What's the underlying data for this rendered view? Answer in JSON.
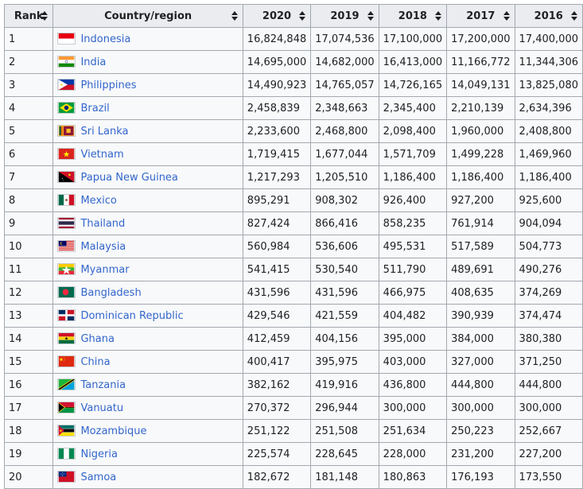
{
  "columns": {
    "rank": "Rank",
    "country": "Country/region",
    "y2020": "2020",
    "y2019": "2019",
    "y2018": "2018",
    "y2017": "2017",
    "y2016": "2016"
  },
  "rows": [
    {
      "rank": "1",
      "country": "Indonesia",
      "flag": "indonesia-flag-icon",
      "v2020": "16,824,848",
      "v2019": "17,074,536",
      "v2018": "17,100,000",
      "v2017": "17,200,000",
      "v2016": "17,400,000"
    },
    {
      "rank": "2",
      "country": "India",
      "flag": "india-flag-icon",
      "v2020": "14,695,000",
      "v2019": "14,682,000",
      "v2018": "16,413,000",
      "v2017": "11,166,772",
      "v2016": "11,344,306"
    },
    {
      "rank": "3",
      "country": "Philippines",
      "flag": "philippines-flag-icon",
      "v2020": "14,490,923",
      "v2019": "14,765,057",
      "v2018": "14,726,165",
      "v2017": "14,049,131",
      "v2016": "13,825,080"
    },
    {
      "rank": "4",
      "country": "Brazil",
      "flag": "brazil-flag-icon",
      "v2020": "2,458,839",
      "v2019": "2,348,663",
      "v2018": "2,345,400",
      "v2017": "2,210,139",
      "v2016": "2,634,396"
    },
    {
      "rank": "5",
      "country": "Sri Lanka",
      "flag": "sri-lanka-flag-icon",
      "v2020": "2,233,600",
      "v2019": "2,468,800",
      "v2018": "2,098,400",
      "v2017": "1,960,000",
      "v2016": "2,408,800"
    },
    {
      "rank": "6",
      "country": "Vietnam",
      "flag": "vietnam-flag-icon",
      "v2020": "1,719,415",
      "v2019": "1,677,044",
      "v2018": "1,571,709",
      "v2017": "1,499,228",
      "v2016": "1,469,960"
    },
    {
      "rank": "7",
      "country": "Papua New Guinea",
      "flag": "papua-new-guinea-flag-icon",
      "v2020": "1,217,293",
      "v2019": "1,205,510",
      "v2018": "1,186,400",
      "v2017": "1,186,400",
      "v2016": "1,186,400"
    },
    {
      "rank": "8",
      "country": "Mexico",
      "flag": "mexico-flag-icon",
      "v2020": "895,291",
      "v2019": "908,302",
      "v2018": "926,400",
      "v2017": "927,200",
      "v2016": "925,600"
    },
    {
      "rank": "9",
      "country": "Thailand",
      "flag": "thailand-flag-icon",
      "v2020": "827,424",
      "v2019": "866,416",
      "v2018": "858,235",
      "v2017": "761,914",
      "v2016": "904,094"
    },
    {
      "rank": "10",
      "country": "Malaysia",
      "flag": "malaysia-flag-icon",
      "v2020": "560,984",
      "v2019": "536,606",
      "v2018": "495,531",
      "v2017": "517,589",
      "v2016": "504,773"
    },
    {
      "rank": "11",
      "country": "Myanmar",
      "flag": "myanmar-flag-icon",
      "v2020": "541,415",
      "v2019": "530,540",
      "v2018": "511,790",
      "v2017": "489,691",
      "v2016": "490,276"
    },
    {
      "rank": "12",
      "country": "Bangladesh",
      "flag": "bangladesh-flag-icon",
      "v2020": "431,596",
      "v2019": "431,596",
      "v2018": "466,975",
      "v2017": "408,635",
      "v2016": "374,269"
    },
    {
      "rank": "13",
      "country": "Dominican Republic",
      "flag": "dominican-republic-flag-icon",
      "v2020": "429,546",
      "v2019": "421,559",
      "v2018": "404,482",
      "v2017": "390,939",
      "v2016": "374,474"
    },
    {
      "rank": "14",
      "country": "Ghana",
      "flag": "ghana-flag-icon",
      "v2020": "412,459",
      "v2019": "404,156",
      "v2018": "395,000",
      "v2017": "384,000",
      "v2016": "380,380"
    },
    {
      "rank": "15",
      "country": "China",
      "flag": "china-flag-icon",
      "v2020": "400,417",
      "v2019": "395,975",
      "v2018": "403,000",
      "v2017": "327,000",
      "v2016": "371,250"
    },
    {
      "rank": "16",
      "country": "Tanzania",
      "flag": "tanzania-flag-icon",
      "v2020": "382,162",
      "v2019": "419,916",
      "v2018": "436,800",
      "v2017": "444,800",
      "v2016": "444,800"
    },
    {
      "rank": "17",
      "country": "Vanuatu",
      "flag": "vanuatu-flag-icon",
      "v2020": "270,372",
      "v2019": "296,944",
      "v2018": "300,000",
      "v2017": "300,000",
      "v2016": "300,000"
    },
    {
      "rank": "18",
      "country": "Mozambique",
      "flag": "mozambique-flag-icon",
      "v2020": "251,122",
      "v2019": "251,508",
      "v2018": "251,634",
      "v2017": "250,223",
      "v2016": "252,667"
    },
    {
      "rank": "19",
      "country": "Nigeria",
      "flag": "nigeria-flag-icon",
      "v2020": "225,574",
      "v2019": "228,645",
      "v2018": "228,000",
      "v2017": "231,200",
      "v2016": "227,200"
    },
    {
      "rank": "20",
      "country": "Samoa",
      "flag": "samoa-flag-icon",
      "v2020": "182,672",
      "v2019": "181,148",
      "v2018": "180,863",
      "v2017": "176,193",
      "v2016": "173,550"
    }
  ],
  "colors": {
    "header_bg": "#eaecf0",
    "cell_bg": "#f8f9fa",
    "border": "#a2a9b1",
    "link": "#3366cc",
    "text": "#202122"
  }
}
